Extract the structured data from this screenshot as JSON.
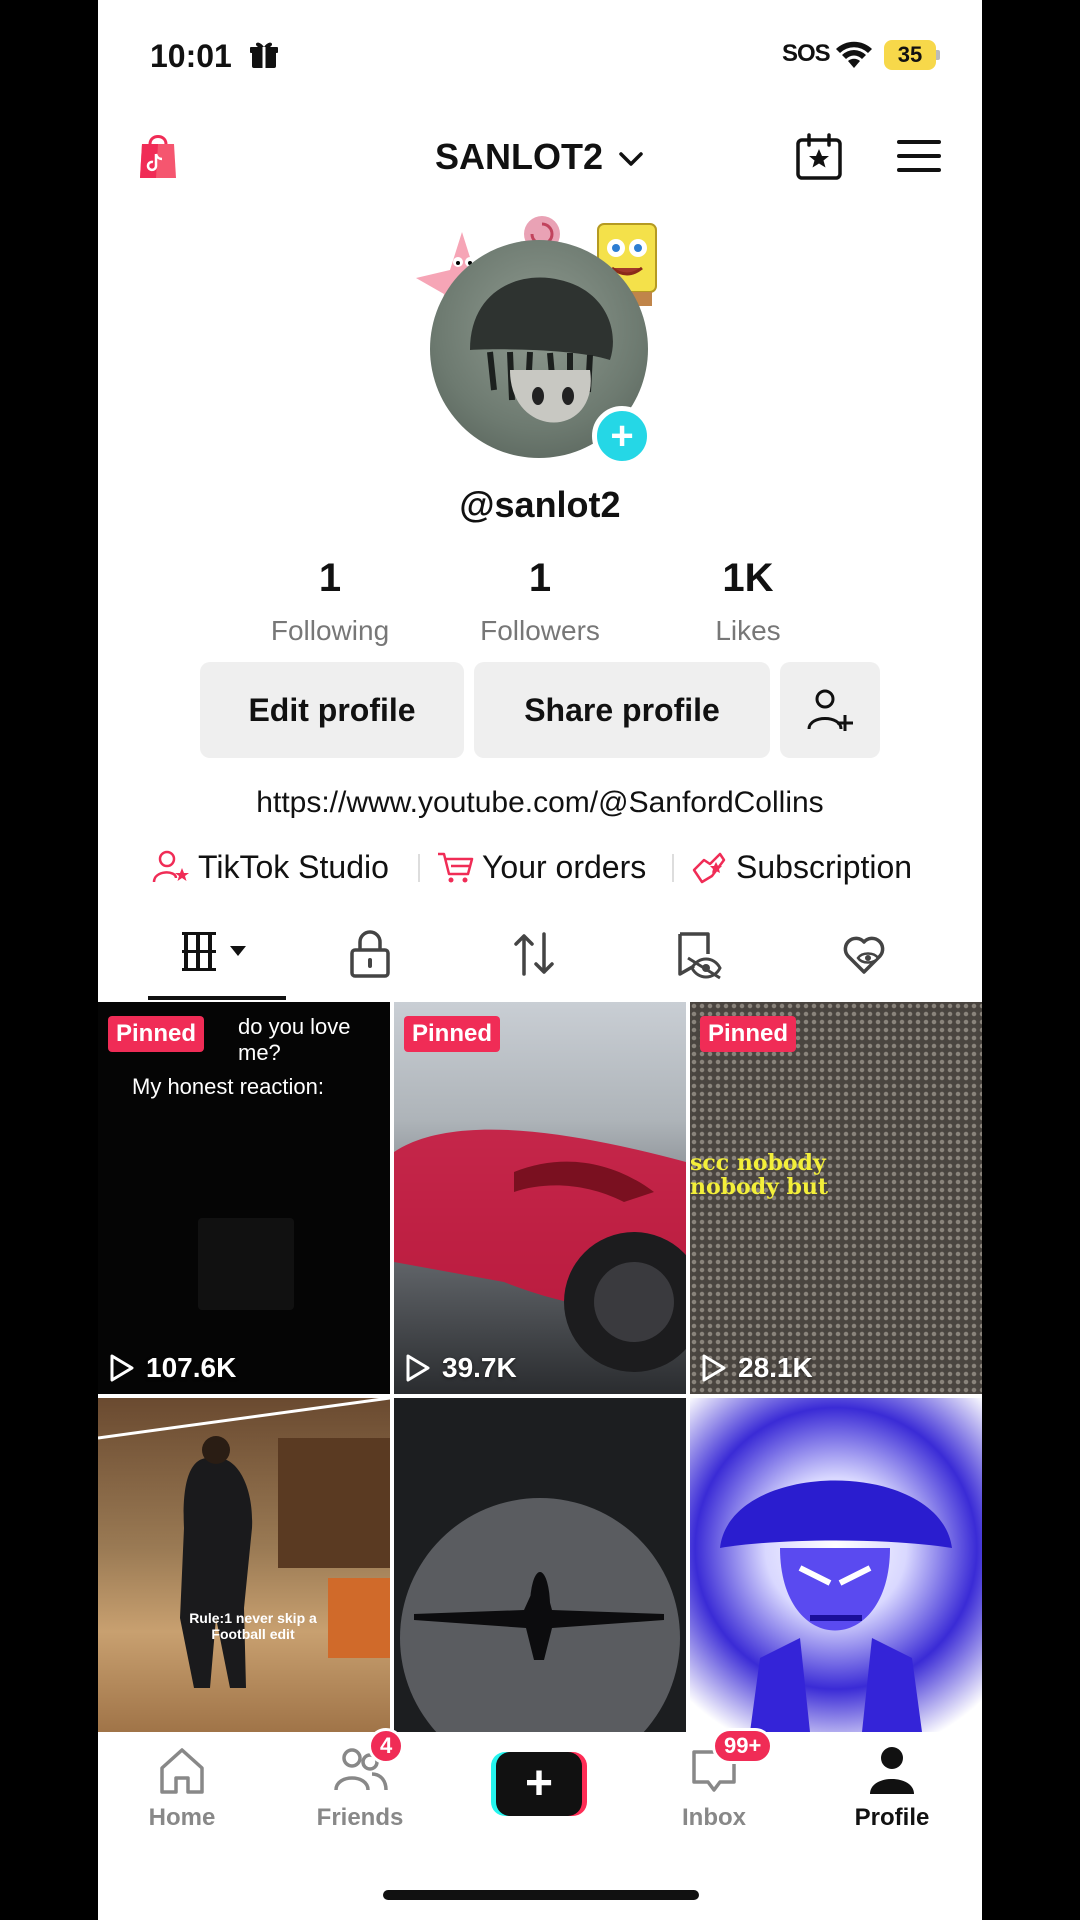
{
  "status_bar": {
    "time": "10:01",
    "carrier": "SOS",
    "battery": "35"
  },
  "header": {
    "username": "SANLOT2"
  },
  "profile": {
    "handle": "@sanlot2",
    "stats": [
      {
        "num": "1",
        "label": "Following"
      },
      {
        "num": "1",
        "label": "Followers"
      },
      {
        "num": "1K",
        "label": "Likes"
      }
    ],
    "edit_label": "Edit profile",
    "share_label": "Share profile",
    "bio_link": "https://www.youtube.com/@SanfordCollins"
  },
  "tools": [
    {
      "label": "TikTok Studio",
      "icon": "studio-icon"
    },
    {
      "label": "Your orders",
      "icon": "cart-icon"
    },
    {
      "label": "Subscription",
      "icon": "subscription-icon"
    }
  ],
  "tabs": [
    "videos-grid-icon",
    "lock-icon",
    "repost-icon",
    "hidden-icon",
    "liked-icon"
  ],
  "videos": [
    {
      "pinned": "Pinned",
      "views": "107.6K",
      "caption": "do you love me?",
      "subcaption": "My honest reaction:"
    },
    {
      "pinned": "Pinned",
      "views": "39.7K"
    },
    {
      "pinned": "Pinned",
      "views": "28.1K",
      "overlay1": "scc nobody",
      "overlay2": "nobody  but"
    },
    {
      "caption": "Rule:1 never skip a Football edit"
    },
    {},
    {}
  ],
  "nav": {
    "home": "Home",
    "friends": "Friends",
    "friends_badge": "4",
    "inbox": "Inbox",
    "inbox_badge": "99+",
    "profile": "Profile"
  },
  "colors": {
    "accent": "#f02c56",
    "teal": "#25d7e6"
  }
}
